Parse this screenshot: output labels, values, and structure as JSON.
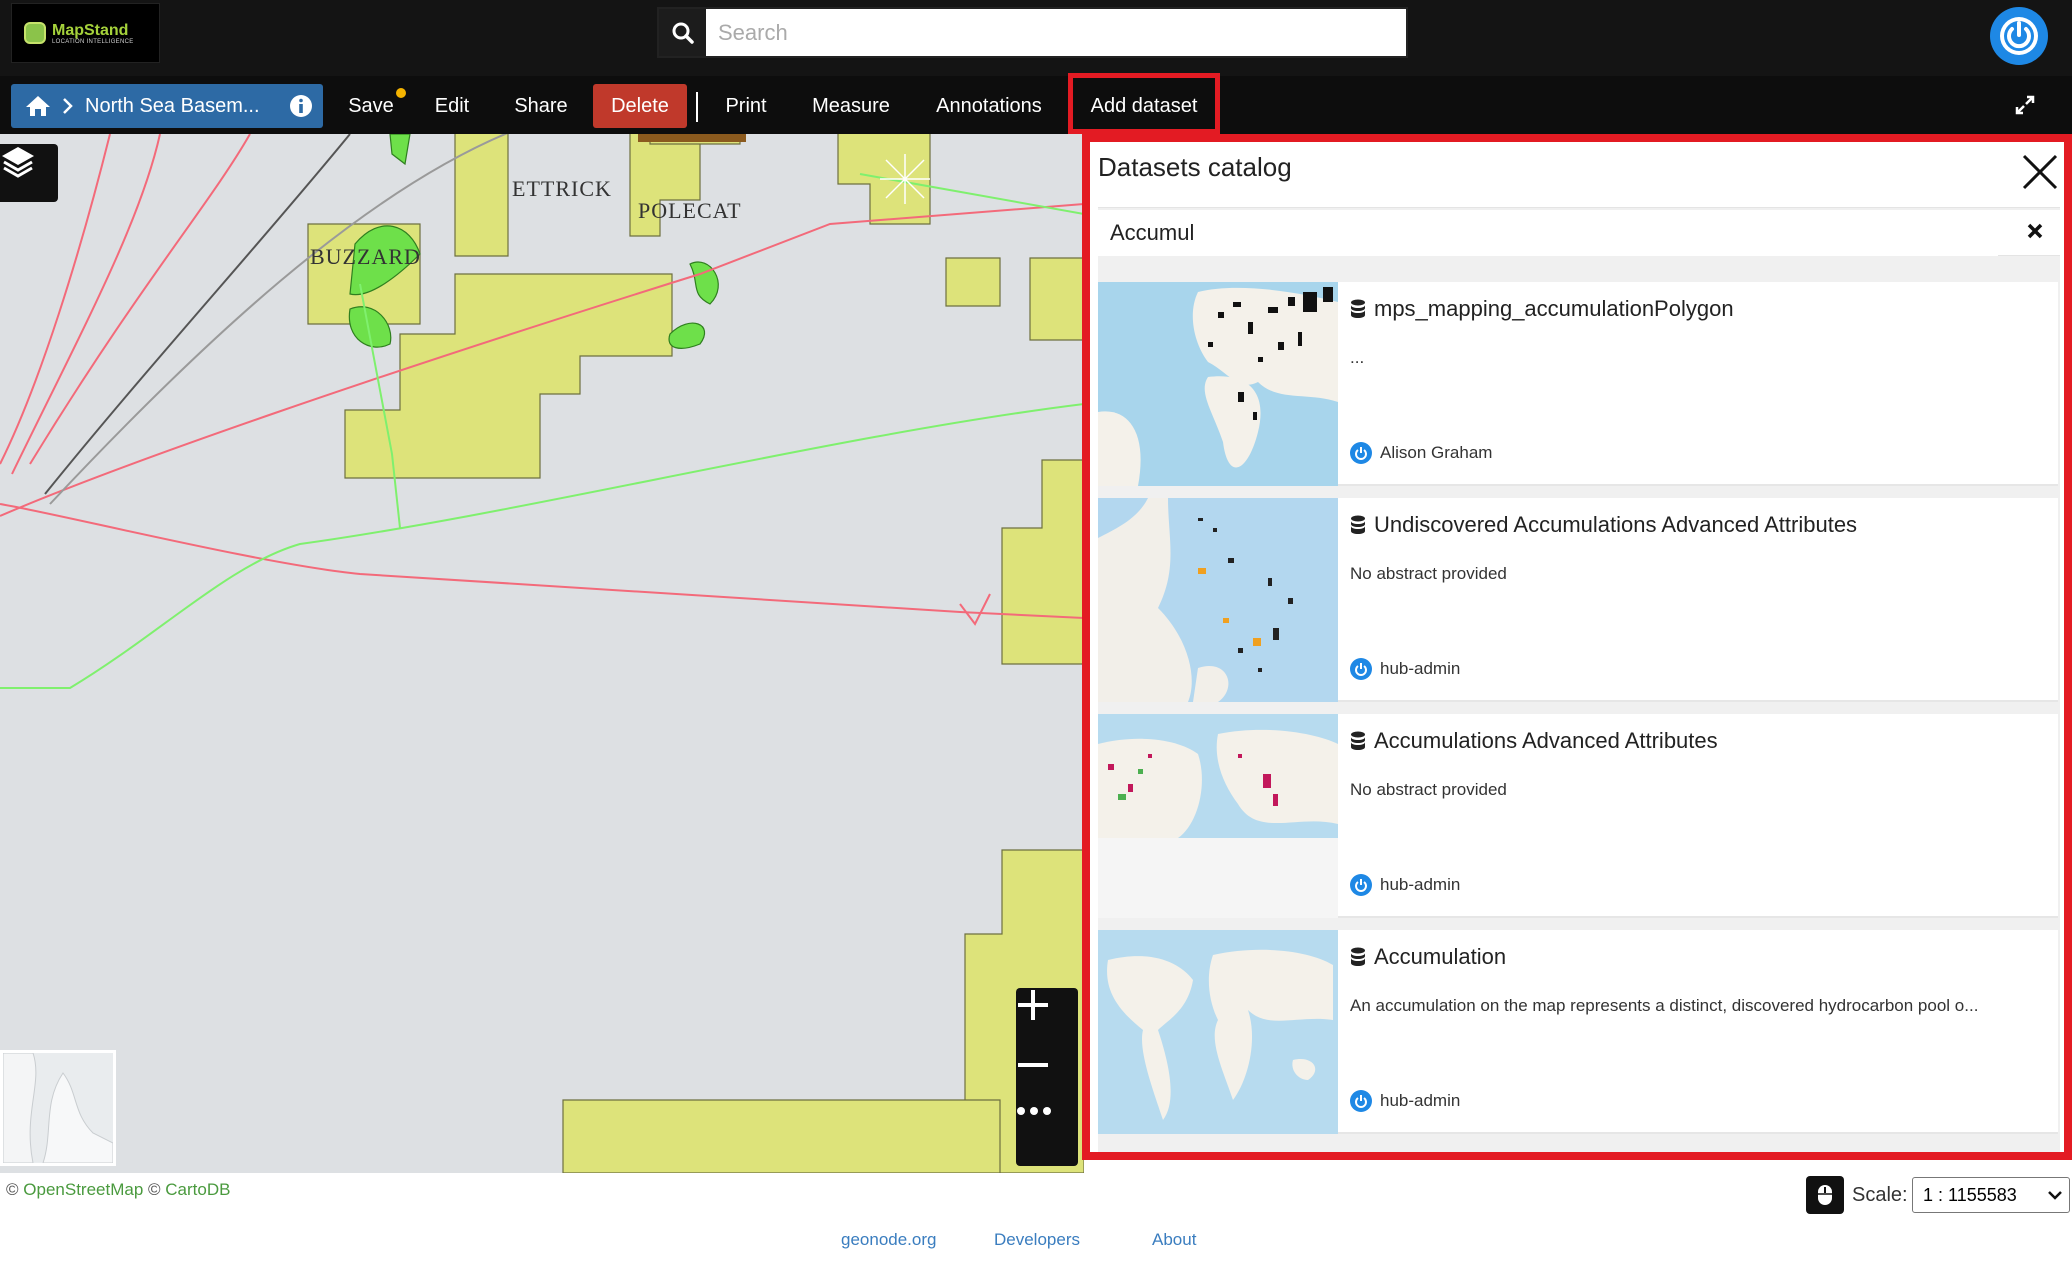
{
  "app": {
    "logo_title": "MapStand",
    "logo_subtitle": "LOCATION INTELLIGENCE",
    "search_placeholder": "Search"
  },
  "toolbar": {
    "map_title": "North Sea Basem...",
    "save": "Save",
    "edit": "Edit",
    "share": "Share",
    "delete": "Delete",
    "print": "Print",
    "measure": "Measure",
    "annotations": "Annotations",
    "add_dataset": "Add dataset",
    "colors": {
      "delete_bg": "#c0392b",
      "crumb_bg": "#2d6aa5",
      "unsaved_dot": "#f5b400",
      "highlight": "#e31b23"
    }
  },
  "map": {
    "labels": [
      "ETTRICK",
      "POLECAT",
      "BUZZARD"
    ],
    "zoom_in": "+",
    "zoom_out": "−",
    "more": "•••"
  },
  "catalog": {
    "title": "Datasets catalog",
    "search_value": "Accumul",
    "items": [
      {
        "title": "mps_mapping_accumulationPolygon",
        "abstract": "...",
        "owner": "Alison Graham",
        "icon": "database-icon"
      },
      {
        "title": "Undiscovered Accumulations Advanced Attributes",
        "abstract": "No abstract provided",
        "owner": "hub-admin",
        "icon": "database-icon"
      },
      {
        "title": "Accumulations Advanced Attributes",
        "abstract": "No abstract provided",
        "owner": "hub-admin",
        "icon": "database-icon"
      },
      {
        "title": "Accumulation",
        "abstract": "An accumulation on the map represents a distinct, discovered hydrocarbon pool o...",
        "owner": "hub-admin",
        "icon": "database-icon"
      }
    ]
  },
  "footer": {
    "copy1": "©",
    "osm": "OpenStreetMap",
    "copy2": "©",
    "carto": "CartoDB",
    "scale_label": "Scale:",
    "scale_value": "1 : 1155583",
    "links": [
      "geonode.org",
      "Developers",
      "About"
    ]
  }
}
